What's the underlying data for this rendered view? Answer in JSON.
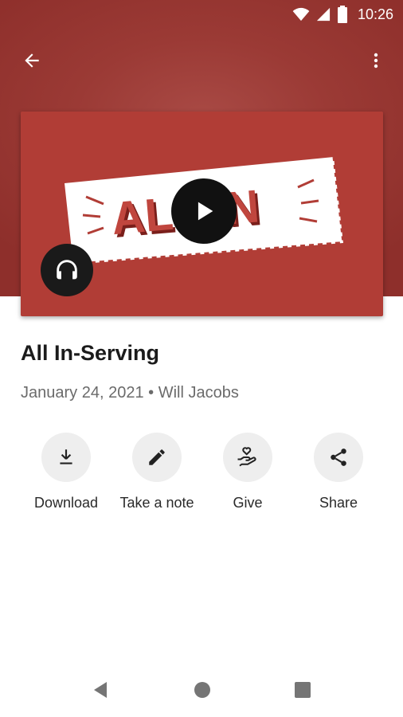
{
  "status_bar": {
    "time": "10:26"
  },
  "artwork": {
    "logo_text": "ALL IN",
    "colors": {
      "background": "#b13d36",
      "banner": "#ffffff",
      "accent": "#b13d36"
    }
  },
  "sermon": {
    "title": "All In-Serving",
    "date": "January 24, 2021",
    "separator": "•",
    "speaker": "Will Jacobs"
  },
  "actions": [
    {
      "label": "Download",
      "icon": "download-icon"
    },
    {
      "label": "Take a note",
      "icon": "pencil-icon"
    },
    {
      "label": "Give",
      "icon": "give-hand-heart-icon"
    },
    {
      "label": "Share",
      "icon": "share-icon"
    }
  ],
  "colors": {
    "header": "#9b3a35",
    "action_bg": "#eeeeee",
    "meta_text": "#6b6b6b"
  }
}
